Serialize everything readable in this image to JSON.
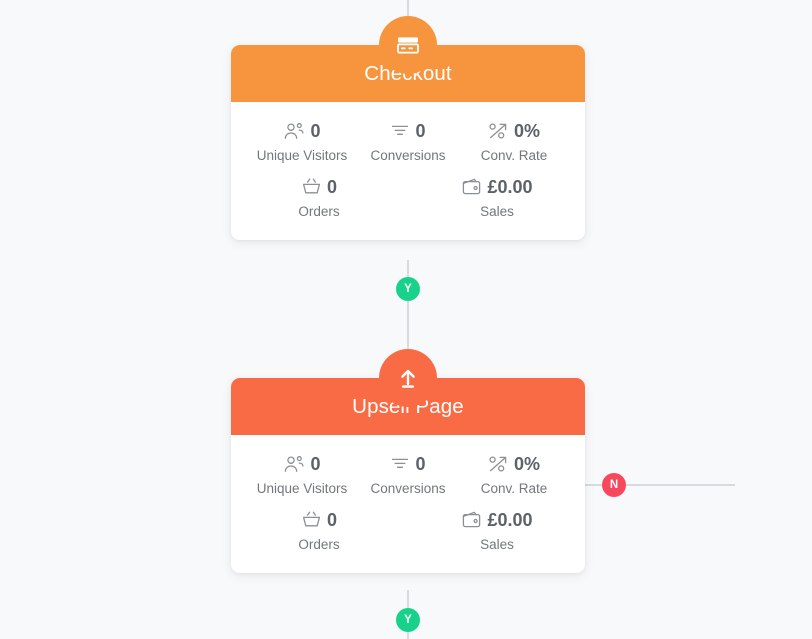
{
  "theme": {
    "background": "#f8f9fb",
    "card_background": "#ffffff",
    "line_color": "#d7dade",
    "yes_badge_color": "#18d18b",
    "no_badge_color": "#f8485e",
    "stat_label_color": "#72777d",
    "stat_value_color": "#5d6268"
  },
  "nodes": [
    {
      "id": "checkout",
      "title": "Checkout",
      "header_color": "#f7943e",
      "icon": "credit-card-icon",
      "stats": [
        {
          "icon": "users-icon",
          "value": "0",
          "label": "Unique Visitors"
        },
        {
          "icon": "funnel-icon",
          "value": "0",
          "label": "Conversions"
        },
        {
          "icon": "percent-rise-icon",
          "value": "0%",
          "label": "Conv. Rate"
        },
        {
          "icon": "basket-icon",
          "value": "0",
          "label": "Orders"
        },
        {
          "icon": "wallet-icon",
          "value": "£0.00",
          "label": "Sales"
        }
      ]
    },
    {
      "id": "upsell-page",
      "title": "Upsell Page",
      "header_color": "#f96b45",
      "icon": "arrow-up-upload-icon",
      "stats": [
        {
          "icon": "users-icon",
          "value": "0",
          "label": "Unique Visitors"
        },
        {
          "icon": "funnel-icon",
          "value": "0",
          "label": "Conversions"
        },
        {
          "icon": "percent-rise-icon",
          "value": "0%",
          "label": "Conv. Rate"
        },
        {
          "icon": "basket-icon",
          "value": "0",
          "label": "Orders"
        },
        {
          "icon": "wallet-icon",
          "value": "£0.00",
          "label": "Sales"
        }
      ]
    }
  ],
  "connectors": [
    {
      "id": "checkout-yes",
      "label": "Y",
      "type": "yes"
    },
    {
      "id": "upsell-no",
      "label": "N",
      "type": "no"
    },
    {
      "id": "upsell-yes",
      "label": "Y",
      "type": "yes"
    }
  ]
}
